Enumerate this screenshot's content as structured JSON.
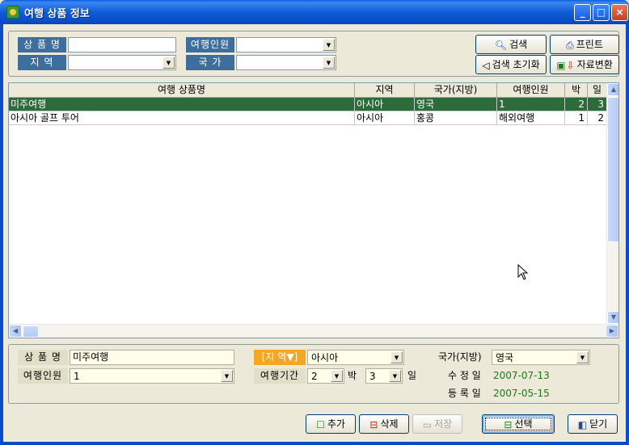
{
  "window": {
    "title": "여행 상품 정보",
    "minimize": "_",
    "maximize": "□",
    "close": "×"
  },
  "search": {
    "product_label": "상 품 명",
    "product_value": "",
    "travelers_label": "여행인원",
    "travelers_value": "",
    "region_label": "지    역",
    "region_value": "",
    "country_label": "국    가",
    "country_value": "",
    "search_button": "검색",
    "print_button": "프린트",
    "reset_button": "검색 초기화",
    "convert_button": "자료변환"
  },
  "grid": {
    "columns": [
      "여행 상품명",
      "지역",
      "국가(지방)",
      "여행인원",
      "박",
      "일"
    ],
    "rows": [
      {
        "name": "미주여행",
        "region": "아시아",
        "country": "영국",
        "travelers": "1",
        "nights": "2",
        "days": "3",
        "selected": true
      },
      {
        "name": "아시아 골프 투어",
        "region": "아시아",
        "country": "홍콩",
        "travelers": "해외여행",
        "nights": "1",
        "days": "2",
        "selected": false
      }
    ]
  },
  "detail": {
    "product_label": "상 품 명",
    "product_value": "미주여행",
    "region_label": "[지 역▼]",
    "region_value": "아시아",
    "country_label": "국가(지방)",
    "country_value": "영국",
    "travelers_label": "여행인원",
    "travelers_value": "1",
    "period_label": "여행기간",
    "nights_value": "2",
    "nights_unit": "박",
    "days_value": "3",
    "days_unit": "일",
    "modified_label": "수 정 일",
    "modified_value": "2007-07-13",
    "registered_label": "등 록 일",
    "registered_value": "2007-05-15"
  },
  "actions": {
    "add": "추가",
    "delete": "삭제",
    "save": "저장",
    "select": "선택",
    "close": "닫기"
  },
  "colors": {
    "label_bg": "#3E6E9E",
    "selected_row": "#2E6B3A",
    "accent_orange": "#F5A623",
    "date_text": "#1A7A1A"
  }
}
